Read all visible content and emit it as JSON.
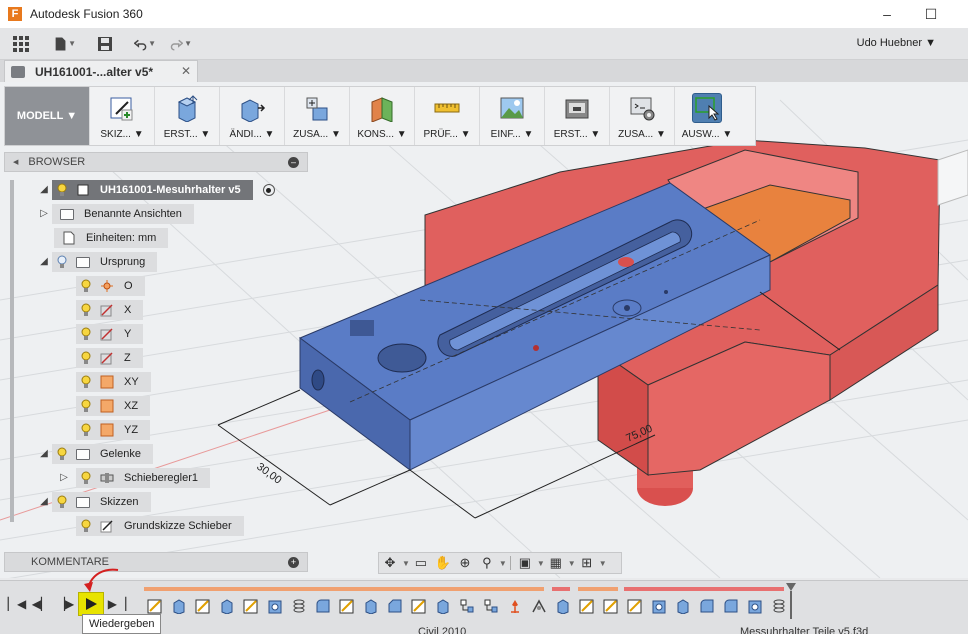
{
  "window": {
    "app_logo": "F",
    "title": "Autodesk Fusion 360",
    "minimize": "–",
    "maximize": "☐"
  },
  "quick_access": {
    "user_name": "Udo Huebner ▼"
  },
  "document_tab": {
    "label": "UH161001-...alter v5*",
    "close": "✕"
  },
  "ribbon": {
    "workspace": "MODELL ▼",
    "tools": [
      {
        "label": "SKIZ... ▼",
        "icon": "sketch-icon"
      },
      {
        "label": "ERST... ▼",
        "icon": "create-icon"
      },
      {
        "label": "ÄNDI... ▼",
        "icon": "modify-icon"
      },
      {
        "label": "ZUSA... ▼",
        "icon": "assemble-icon"
      },
      {
        "label": "KONS... ▼",
        "icon": "construct-icon"
      },
      {
        "label": "PRÜF... ▼",
        "icon": "inspect-icon"
      },
      {
        "label": "EINF... ▼",
        "icon": "insert-icon"
      },
      {
        "label": "ERST... ▼",
        "icon": "make-icon"
      },
      {
        "label": "ZUSA... ▼",
        "icon": "addins-icon"
      },
      {
        "label": "AUSW... ▼",
        "icon": "select-icon"
      }
    ]
  },
  "browser": {
    "title": "BROWSER",
    "items": [
      {
        "label": "UH161001-Mesuhrhalter v5"
      },
      {
        "label": "Benannte Ansichten"
      },
      {
        "label": "Einheiten: mm"
      },
      {
        "label": "Ursprung"
      },
      {
        "label": "O"
      },
      {
        "label": "X"
      },
      {
        "label": "Y"
      },
      {
        "label": "Z"
      },
      {
        "label": "XY"
      },
      {
        "label": "XZ"
      },
      {
        "label": "YZ"
      },
      {
        "label": "Gelenke"
      },
      {
        "label": "Schieberegler1"
      },
      {
        "label": "Skizzen"
      },
      {
        "label": "Grundskizze Schieber"
      }
    ]
  },
  "comments": {
    "title": "KOMMENTARE"
  },
  "viewport": {
    "dimension_1": "30,00",
    "dimension_2": "75,00",
    "body_colors": {
      "red": "#e2605e",
      "blue": "#5577c4",
      "orange": "#e8823e"
    }
  },
  "timeline": {
    "tooltip": "Wiedergeben"
  },
  "bottom": {
    "left_text": "Civil 2010",
    "right_text": "Messuhrhalter Teile v5.f3d"
  }
}
